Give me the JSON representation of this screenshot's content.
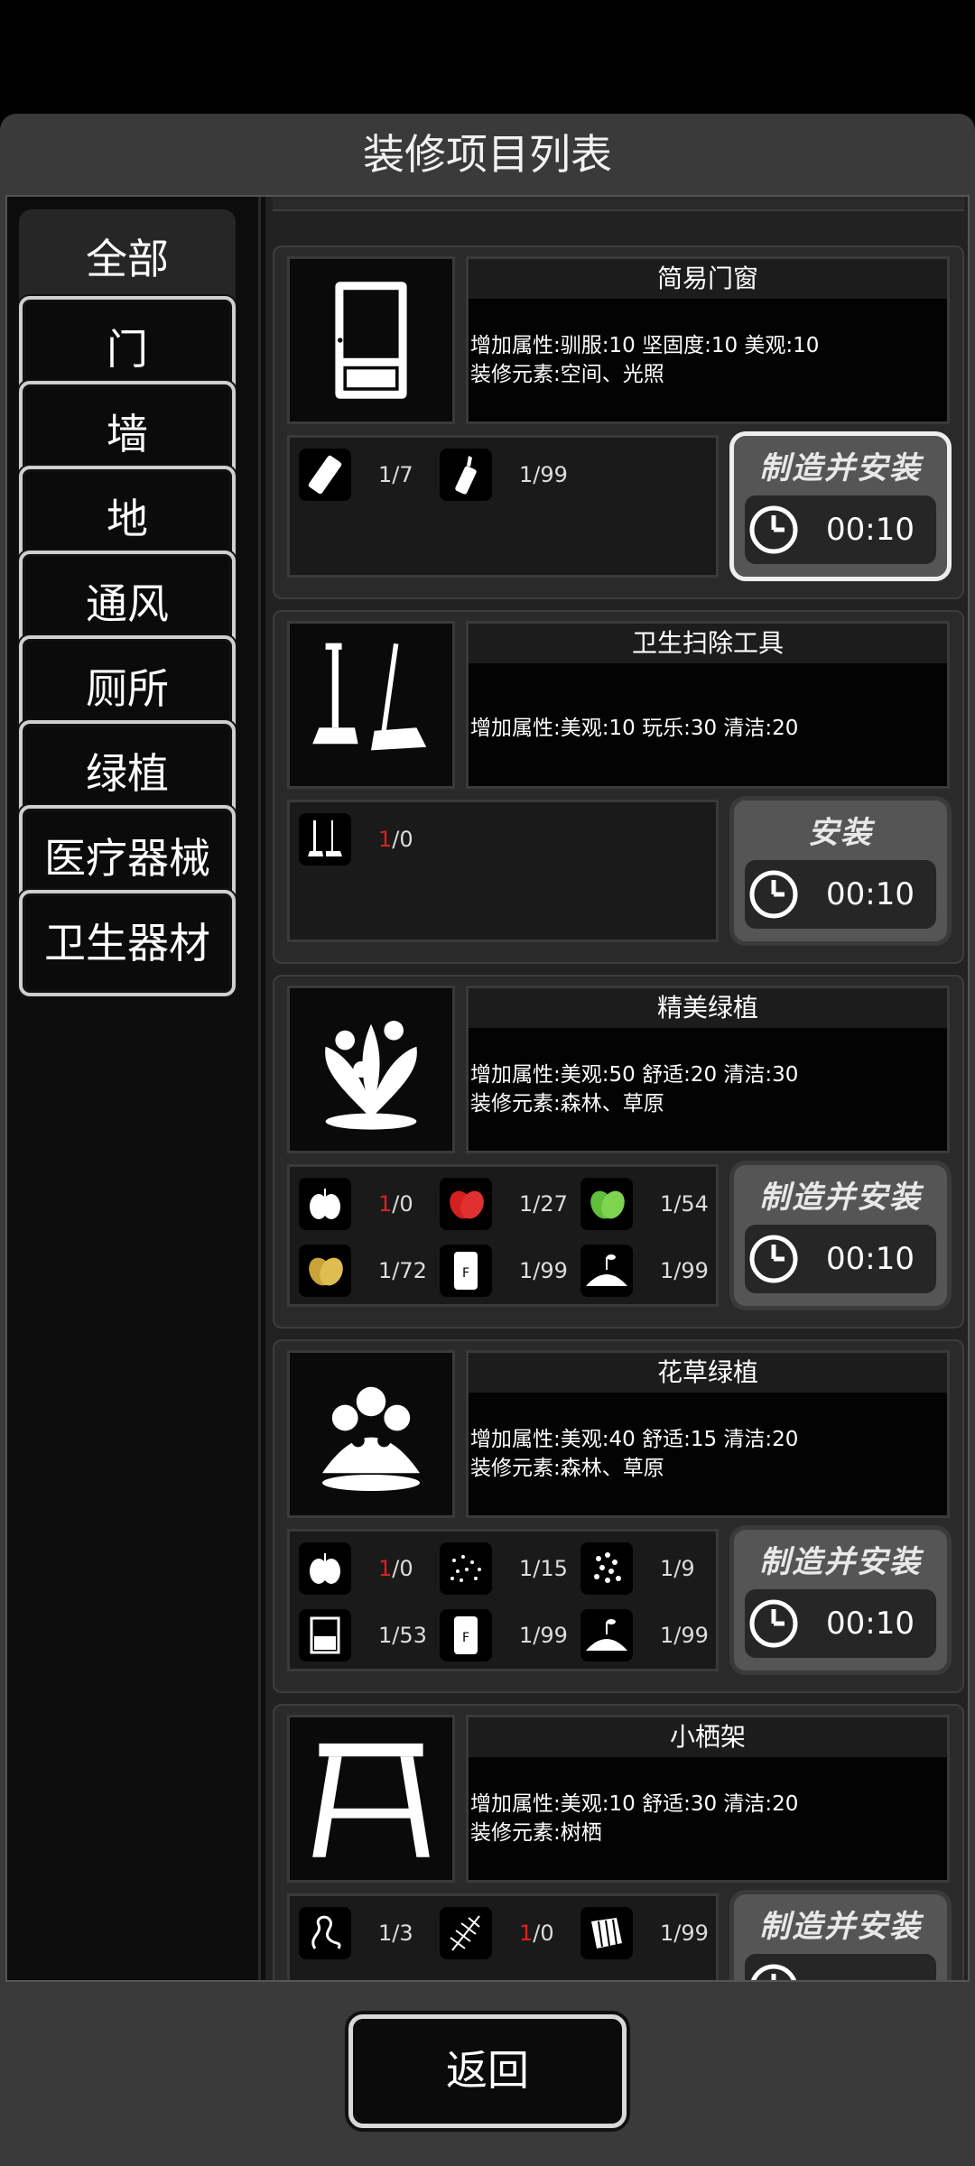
{
  "title": "装修项目列表",
  "categories": [
    "全部",
    "门",
    "墙",
    "地",
    "通风",
    "厕所",
    "绿植",
    "医疗器械",
    "卫生器材"
  ],
  "back_label": "返回",
  "items": [
    {
      "name": "简易门窗",
      "lines": [
        "增加属性:驯服:10 坚固度:10 美观:10",
        "装修元素:空间、光照"
      ],
      "materials": [
        {
          "icon": "wood-plank-icon",
          "have": "1",
          "need": "/7",
          "short": false
        },
        {
          "icon": "glue-bottle-icon",
          "have": "1",
          "need": "/99",
          "short": false
        }
      ],
      "action": "制造并安装",
      "time": "00:10"
    },
    {
      "name": "卫生扫除工具",
      "lines": [
        "增加属性:美观:10 玩乐:30 清洁:20"
      ],
      "materials": [
        {
          "icon": "broom-dustpan-icon",
          "have": "1",
          "need": "/0",
          "short": true
        }
      ],
      "action": "安装",
      "time": "00:10"
    },
    {
      "name": "精美绿植",
      "lines": [
        "增加属性:美观:50 舒适:20 清洁:30",
        "装修元素:森林、草原"
      ],
      "materials": [
        {
          "icon": "seed-pod-icon",
          "have": "1",
          "need": "/0",
          "short": true
        },
        {
          "icon": "red-leaf-icon",
          "have": "1",
          "need": "/27",
          "short": false
        },
        {
          "icon": "green-leaf-icon",
          "have": "1",
          "need": "/54",
          "short": false
        },
        {
          "icon": "yellow-leaf-icon",
          "have": "1",
          "need": "/72",
          "short": false
        },
        {
          "icon": "fertilizer-bag-icon",
          "have": "1",
          "need": "/99",
          "short": false
        },
        {
          "icon": "soil-sprout-icon",
          "have": "1",
          "need": "/99",
          "short": false
        }
      ],
      "action": "制造并安装",
      "time": "00:10"
    },
    {
      "name": "花草绿植",
      "lines": [
        "增加属性:美观:40 舒适:15 清洁:20",
        "装修元素:森林、草原"
      ],
      "materials": [
        {
          "icon": "seed-pod-icon",
          "have": "1",
          "need": "/0",
          "short": true
        },
        {
          "icon": "seeds-icon",
          "have": "1",
          "need": "/15",
          "short": false
        },
        {
          "icon": "flower-seeds-icon",
          "have": "1",
          "need": "/9",
          "short": false
        },
        {
          "icon": "flower-pot-icon",
          "have": "1",
          "need": "/53",
          "short": false
        },
        {
          "icon": "fertilizer-bag-icon",
          "have": "1",
          "need": "/99",
          "short": false
        },
        {
          "icon": "soil-sprout-icon",
          "have": "1",
          "need": "/99",
          "short": false
        }
      ],
      "action": "制造并安装",
      "time": "00:10"
    },
    {
      "name": "小栖架",
      "lines": [
        "增加属性:美观:10 舒适:30 清洁:20",
        "装修元素:树栖"
      ],
      "materials": [
        {
          "icon": "vine-icon",
          "have": "1",
          "need": "/3",
          "short": false
        },
        {
          "icon": "fern-icon",
          "have": "1",
          "need": "/0",
          "short": true
        },
        {
          "icon": "bark-icon",
          "have": "1",
          "need": "/99",
          "short": false
        }
      ],
      "action": "制造并安装",
      "time": ""
    }
  ]
}
